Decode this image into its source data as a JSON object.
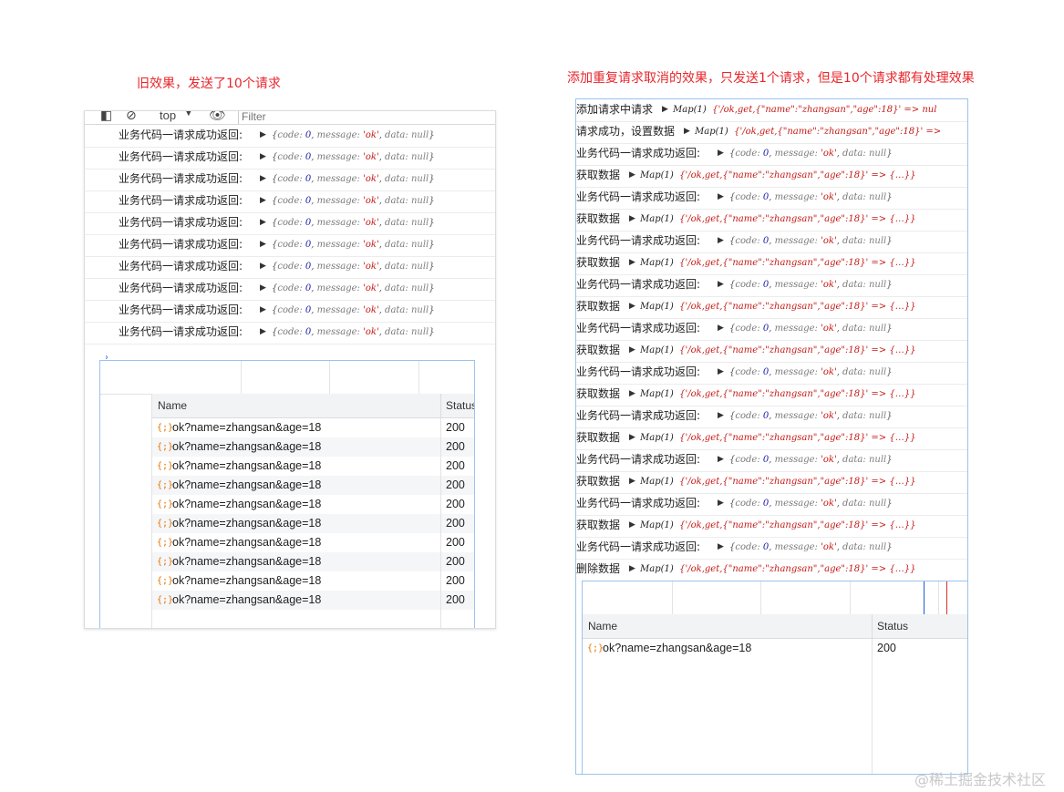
{
  "captions": {
    "left": "旧效果，发送了10个请求",
    "right": "添加重复请求取消的效果，只发送1个请求，但是10个请求都有处理效果"
  },
  "left_console": {
    "context": "top",
    "filter_placeholder": "Filter",
    "logs": [
      {
        "label": "业务代码一请求成功返回:",
        "code": "0",
        "message": "'ok'",
        "data": "null"
      },
      {
        "label": "业务代码一请求成功返回:",
        "code": "0",
        "message": "'ok'",
        "data": "null"
      },
      {
        "label": "业务代码一请求成功返回:",
        "code": "0",
        "message": "'ok'",
        "data": "null"
      },
      {
        "label": "业务代码一请求成功返回:",
        "code": "0",
        "message": "'ok'",
        "data": "null"
      },
      {
        "label": "业务代码一请求成功返回:",
        "code": "0",
        "message": "'ok'",
        "data": "null"
      },
      {
        "label": "业务代码一请求成功返回:",
        "code": "0",
        "message": "'ok'",
        "data": "null"
      },
      {
        "label": "业务代码一请求成功返回:",
        "code": "0",
        "message": "'ok'",
        "data": "null"
      },
      {
        "label": "业务代码一请求成功返回:",
        "code": "0",
        "message": "'ok'",
        "data": "null"
      },
      {
        "label": "业务代码一请求成功返回:",
        "code": "0",
        "message": "'ok'",
        "data": "null"
      },
      {
        "label": "业务代码一请求成功返回:",
        "code": "0",
        "message": "'ok'",
        "data": "null"
      }
    ],
    "prompt": "›"
  },
  "left_network": {
    "columns": {
      "name": "Name",
      "status": "Status"
    },
    "rows": [
      {
        "name": "ok?name=zhangsan&age=18",
        "status": "200"
      },
      {
        "name": "ok?name=zhangsan&age=18",
        "status": "200"
      },
      {
        "name": "ok?name=zhangsan&age=18",
        "status": "200"
      },
      {
        "name": "ok?name=zhangsan&age=18",
        "status": "200"
      },
      {
        "name": "ok?name=zhangsan&age=18",
        "status": "200"
      },
      {
        "name": "ok?name=zhangsan&age=18",
        "status": "200"
      },
      {
        "name": "ok?name=zhangsan&age=18",
        "status": "200"
      },
      {
        "name": "ok?name=zhangsan&age=18",
        "status": "200"
      },
      {
        "name": "ok?name=zhangsan&age=18",
        "status": "200"
      },
      {
        "name": "ok?name=zhangsan&age=18",
        "status": "200"
      }
    ]
  },
  "right_console": {
    "logs": [
      {
        "kind": "map",
        "label": "添加请求中请求",
        "map": "Map(1)",
        "key": "{'/ok,get,{\"name\":\"zhangsan\",\"age\":18}' => nul"
      },
      {
        "kind": "map",
        "label": "请求成功，设置数据",
        "map": "Map(1)",
        "key": "{'/ok,get,{\"name\":\"zhangsan\",\"age\":18}' =>"
      },
      {
        "kind": "res",
        "label": "业务代码一请求成功返回:",
        "code": "0",
        "message": "'ok'",
        "data": "null"
      },
      {
        "kind": "map",
        "label": "获取数据",
        "map": "Map(1)",
        "key": "{'/ok,get,{\"name\":\"zhangsan\",\"age\":18}' => {…}}"
      },
      {
        "kind": "res",
        "label": "业务代码一请求成功返回:",
        "code": "0",
        "message": "'ok'",
        "data": "null"
      },
      {
        "kind": "map",
        "label": "获取数据",
        "map": "Map(1)",
        "key": "{'/ok,get,{\"name\":\"zhangsan\",\"age\":18}' => {…}}"
      },
      {
        "kind": "res",
        "label": "业务代码一请求成功返回:",
        "code": "0",
        "message": "'ok'",
        "data": "null"
      },
      {
        "kind": "map",
        "label": "获取数据",
        "map": "Map(1)",
        "key": "{'/ok,get,{\"name\":\"zhangsan\",\"age\":18}' => {…}}"
      },
      {
        "kind": "res",
        "label": "业务代码一请求成功返回:",
        "code": "0",
        "message": "'ok'",
        "data": "null"
      },
      {
        "kind": "map",
        "label": "获取数据",
        "map": "Map(1)",
        "key": "{'/ok,get,{\"name\":\"zhangsan\",\"age\":18}' => {…}}"
      },
      {
        "kind": "res",
        "label": "业务代码一请求成功返回:",
        "code": "0",
        "message": "'ok'",
        "data": "null"
      },
      {
        "kind": "map",
        "label": "获取数据",
        "map": "Map(1)",
        "key": "{'/ok,get,{\"name\":\"zhangsan\",\"age\":18}' => {…}}"
      },
      {
        "kind": "res",
        "label": "业务代码一请求成功返回:",
        "code": "0",
        "message": "'ok'",
        "data": "null"
      },
      {
        "kind": "map",
        "label": "获取数据",
        "map": "Map(1)",
        "key": "{'/ok,get,{\"name\":\"zhangsan\",\"age\":18}' => {…}}"
      },
      {
        "kind": "res",
        "label": "业务代码一请求成功返回:",
        "code": "0",
        "message": "'ok'",
        "data": "null"
      },
      {
        "kind": "map",
        "label": "获取数据",
        "map": "Map(1)",
        "key": "{'/ok,get,{\"name\":\"zhangsan\",\"age\":18}' => {…}}"
      },
      {
        "kind": "res",
        "label": "业务代码一请求成功返回:",
        "code": "0",
        "message": "'ok'",
        "data": "null"
      },
      {
        "kind": "map",
        "label": "获取数据",
        "map": "Map(1)",
        "key": "{'/ok,get,{\"name\":\"zhangsan\",\"age\":18}' => {…}}"
      },
      {
        "kind": "res",
        "label": "业务代码一请求成功返回:",
        "code": "0",
        "message": "'ok'",
        "data": "null"
      },
      {
        "kind": "map",
        "label": "获取数据",
        "map": "Map(1)",
        "key": "{'/ok,get,{\"name\":\"zhangsan\",\"age\":18}' => {…}}"
      },
      {
        "kind": "res",
        "label": "业务代码一请求成功返回:",
        "code": "0",
        "message": "'ok'",
        "data": "null"
      },
      {
        "kind": "map",
        "label": "删除数据",
        "map": "Map(1)",
        "key": "{'/ok,get,{\"name\":\"zhangsan\",\"age\":18}' => {…}}"
      }
    ]
  },
  "right_network": {
    "columns": {
      "name": "Name",
      "status": "Status"
    },
    "rows": [
      {
        "name": "ok?name=zhangsan&age=18",
        "status": "200"
      }
    ]
  },
  "watermark": "@稀土掘金技术社区",
  "colors": {
    "caption": "#e8262b",
    "panel_border": "#9cc2ef",
    "request_icon": "#e37400"
  }
}
